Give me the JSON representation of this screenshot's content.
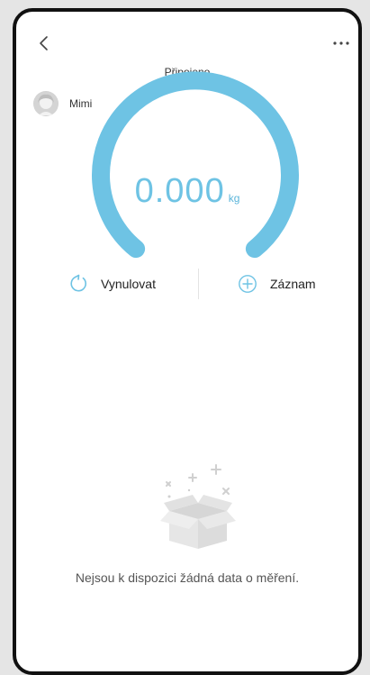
{
  "header": {
    "back_icon": "chevron-left-icon",
    "more_icon": "more-horizontal-icon",
    "status": "Připojeno"
  },
  "user": {
    "name": "Mimi",
    "avatar_icon": "user-avatar-icon"
  },
  "scale": {
    "value": "0.000",
    "unit": "kg",
    "gauge_color": "#6ec3e4"
  },
  "actions": {
    "reset_label": "Vynulovat",
    "reset_icon": "refresh-icon",
    "record_label": "Záznam",
    "record_icon": "plus-circle-icon"
  },
  "empty_state": {
    "icon": "empty-box-icon",
    "message": "Nejsou k dispozici žádná data o měření."
  }
}
